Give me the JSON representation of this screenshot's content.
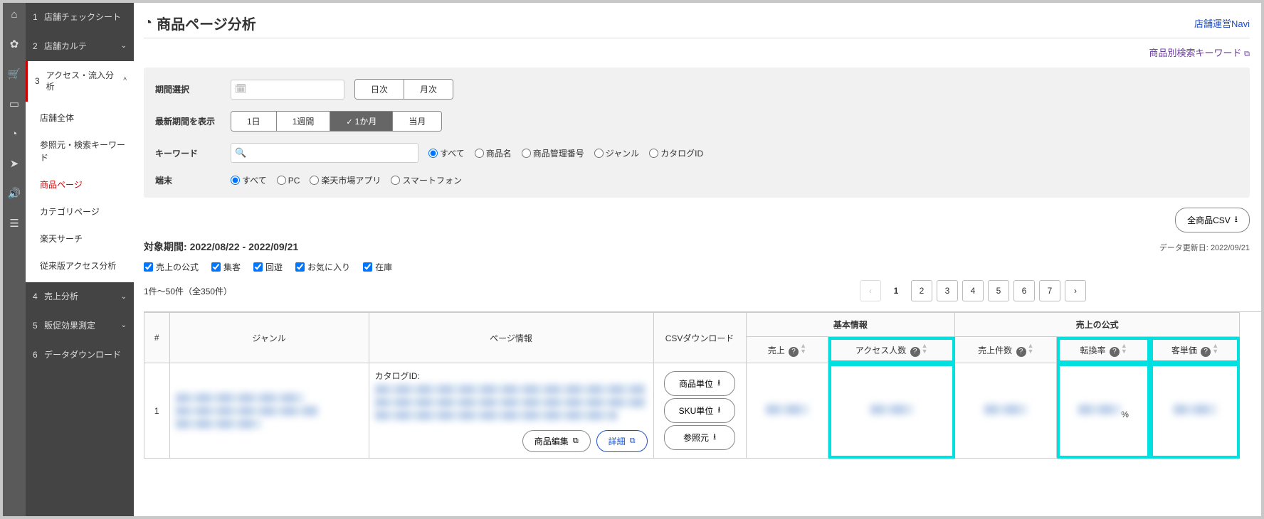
{
  "iconRail": [
    "home",
    "gear",
    "cart",
    "screen",
    "chart",
    "plane",
    "speaker",
    "list"
  ],
  "sidebar": {
    "items": [
      {
        "num": "1",
        "label": "店舗チェックシート",
        "caret": ""
      },
      {
        "num": "2",
        "label": "店舗カルテ",
        "caret": "⌄"
      },
      {
        "num": "3",
        "label": "アクセス・流入分析",
        "caret": "^",
        "open": true,
        "subs": [
          {
            "label": "店舗全体"
          },
          {
            "label": "参照元・検索キーワード"
          },
          {
            "label": "商品ページ",
            "active": true
          },
          {
            "label": "カテゴリページ"
          },
          {
            "label": "楽天サーチ"
          },
          {
            "label": "従来版アクセス分析"
          }
        ]
      },
      {
        "num": "4",
        "label": "売上分析",
        "caret": "⌄"
      },
      {
        "num": "5",
        "label": "販促効果測定",
        "caret": "⌄"
      },
      {
        "num": "6",
        "label": "データダウンロード",
        "caret": ""
      }
    ]
  },
  "header": {
    "title": "商品ページ分析",
    "navi": "店舗運営Navi",
    "kwlink": "商品別検索キーワード"
  },
  "filters": {
    "period_label": "期間選択",
    "date_value": "",
    "freq": [
      {
        "label": "日次"
      },
      {
        "label": "月次"
      }
    ],
    "recent_label": "最新期間を表示",
    "recent": [
      {
        "label": "1日"
      },
      {
        "label": "1週間"
      },
      {
        "label": "1か月",
        "on": true
      },
      {
        "label": "当月"
      }
    ],
    "kw_label": "キーワード",
    "kw_value": "",
    "kw_radios": [
      "すべて",
      "商品名",
      "商品管理番号",
      "ジャンル",
      "カタログID"
    ],
    "device_label": "端末",
    "device_radios": [
      "すべて",
      "PC",
      "楽天市場アプリ",
      "スマートフォン"
    ]
  },
  "csv_all": "全商品CSV",
  "period_range_label": "対象期間:",
  "period_range": "2022/08/22 - 2022/09/21",
  "updated_label": "データ更新日:",
  "updated": "2022/09/21",
  "checks": [
    "売上の公式",
    "集客",
    "回遊",
    "お気に入り",
    "在庫"
  ],
  "pager": {
    "info": "1件～50件（全350件）",
    "pages": [
      "1",
      "2",
      "3",
      "4",
      "5",
      "6",
      "7"
    ]
  },
  "table": {
    "head1": {
      "basic": "基本情報",
      "formula": "売上の公式"
    },
    "head2": {
      "num": "#",
      "genre": "ジャンル",
      "page": "ページ情報",
      "csv": "CSVダウンロード",
      "sales": "売上",
      "access": "アクセス人数",
      "orders": "売上件数",
      "cvr": "転換率",
      "price": "客単価"
    },
    "row": {
      "num": "1",
      "catalog_label": "カタログID:",
      "csv_btns": [
        "商品単位",
        "SKU単位",
        "参照元"
      ],
      "edit": "商品編集",
      "detail": "詳細",
      "cvr_val": "%"
    }
  }
}
